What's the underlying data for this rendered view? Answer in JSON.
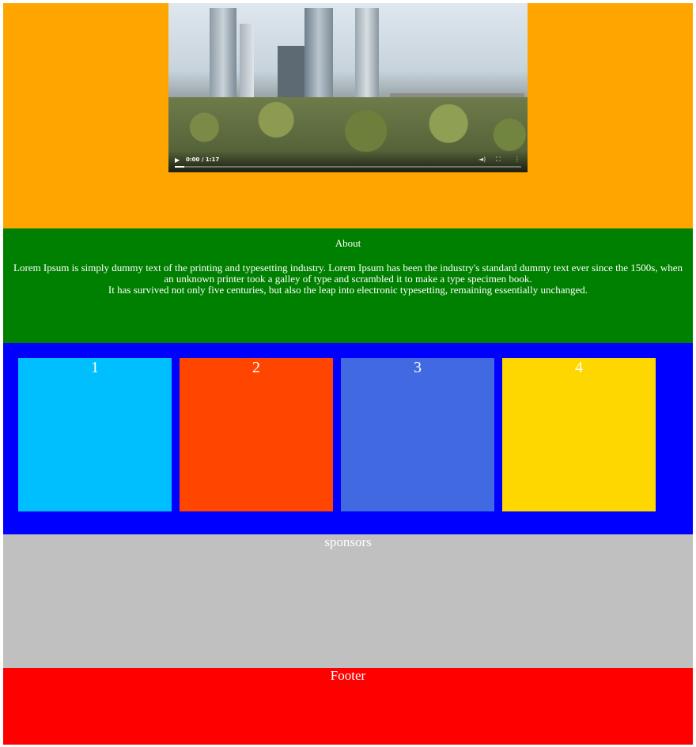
{
  "hero": {
    "background": "#ffa500",
    "video": {
      "time_display": "0:00 / 1:17",
      "progress_fraction": 0.0,
      "icons": [
        "play-icon",
        "volume-icon",
        "fullscreen-icon",
        "more-options-icon"
      ]
    }
  },
  "about": {
    "background": "#008000",
    "title": "About",
    "line1": "Lorem Ipsum is simply dummy text of the printing and typesetting industry. Lorem Ipsum has been the industry's standard dummy text ever since the 1500s, when an unknown printer took a galley of type and scrambled it to make a type specimen book.",
    "line2": "It has survived not only five centuries, but also the leap into electronic typesetting, remaining essentially unchanged."
  },
  "cards": {
    "background": "#0000ff",
    "items": [
      {
        "label": "1",
        "color": "#00bfff"
      },
      {
        "label": "2",
        "color": "#ff4500"
      },
      {
        "label": "3",
        "color": "#4169e1"
      },
      {
        "label": "4",
        "color": "#ffd700"
      }
    ]
  },
  "sponsors": {
    "background": "#c0c0c0",
    "title": "sponsors"
  },
  "footer": {
    "background": "#ff0000",
    "title": "Footer"
  }
}
